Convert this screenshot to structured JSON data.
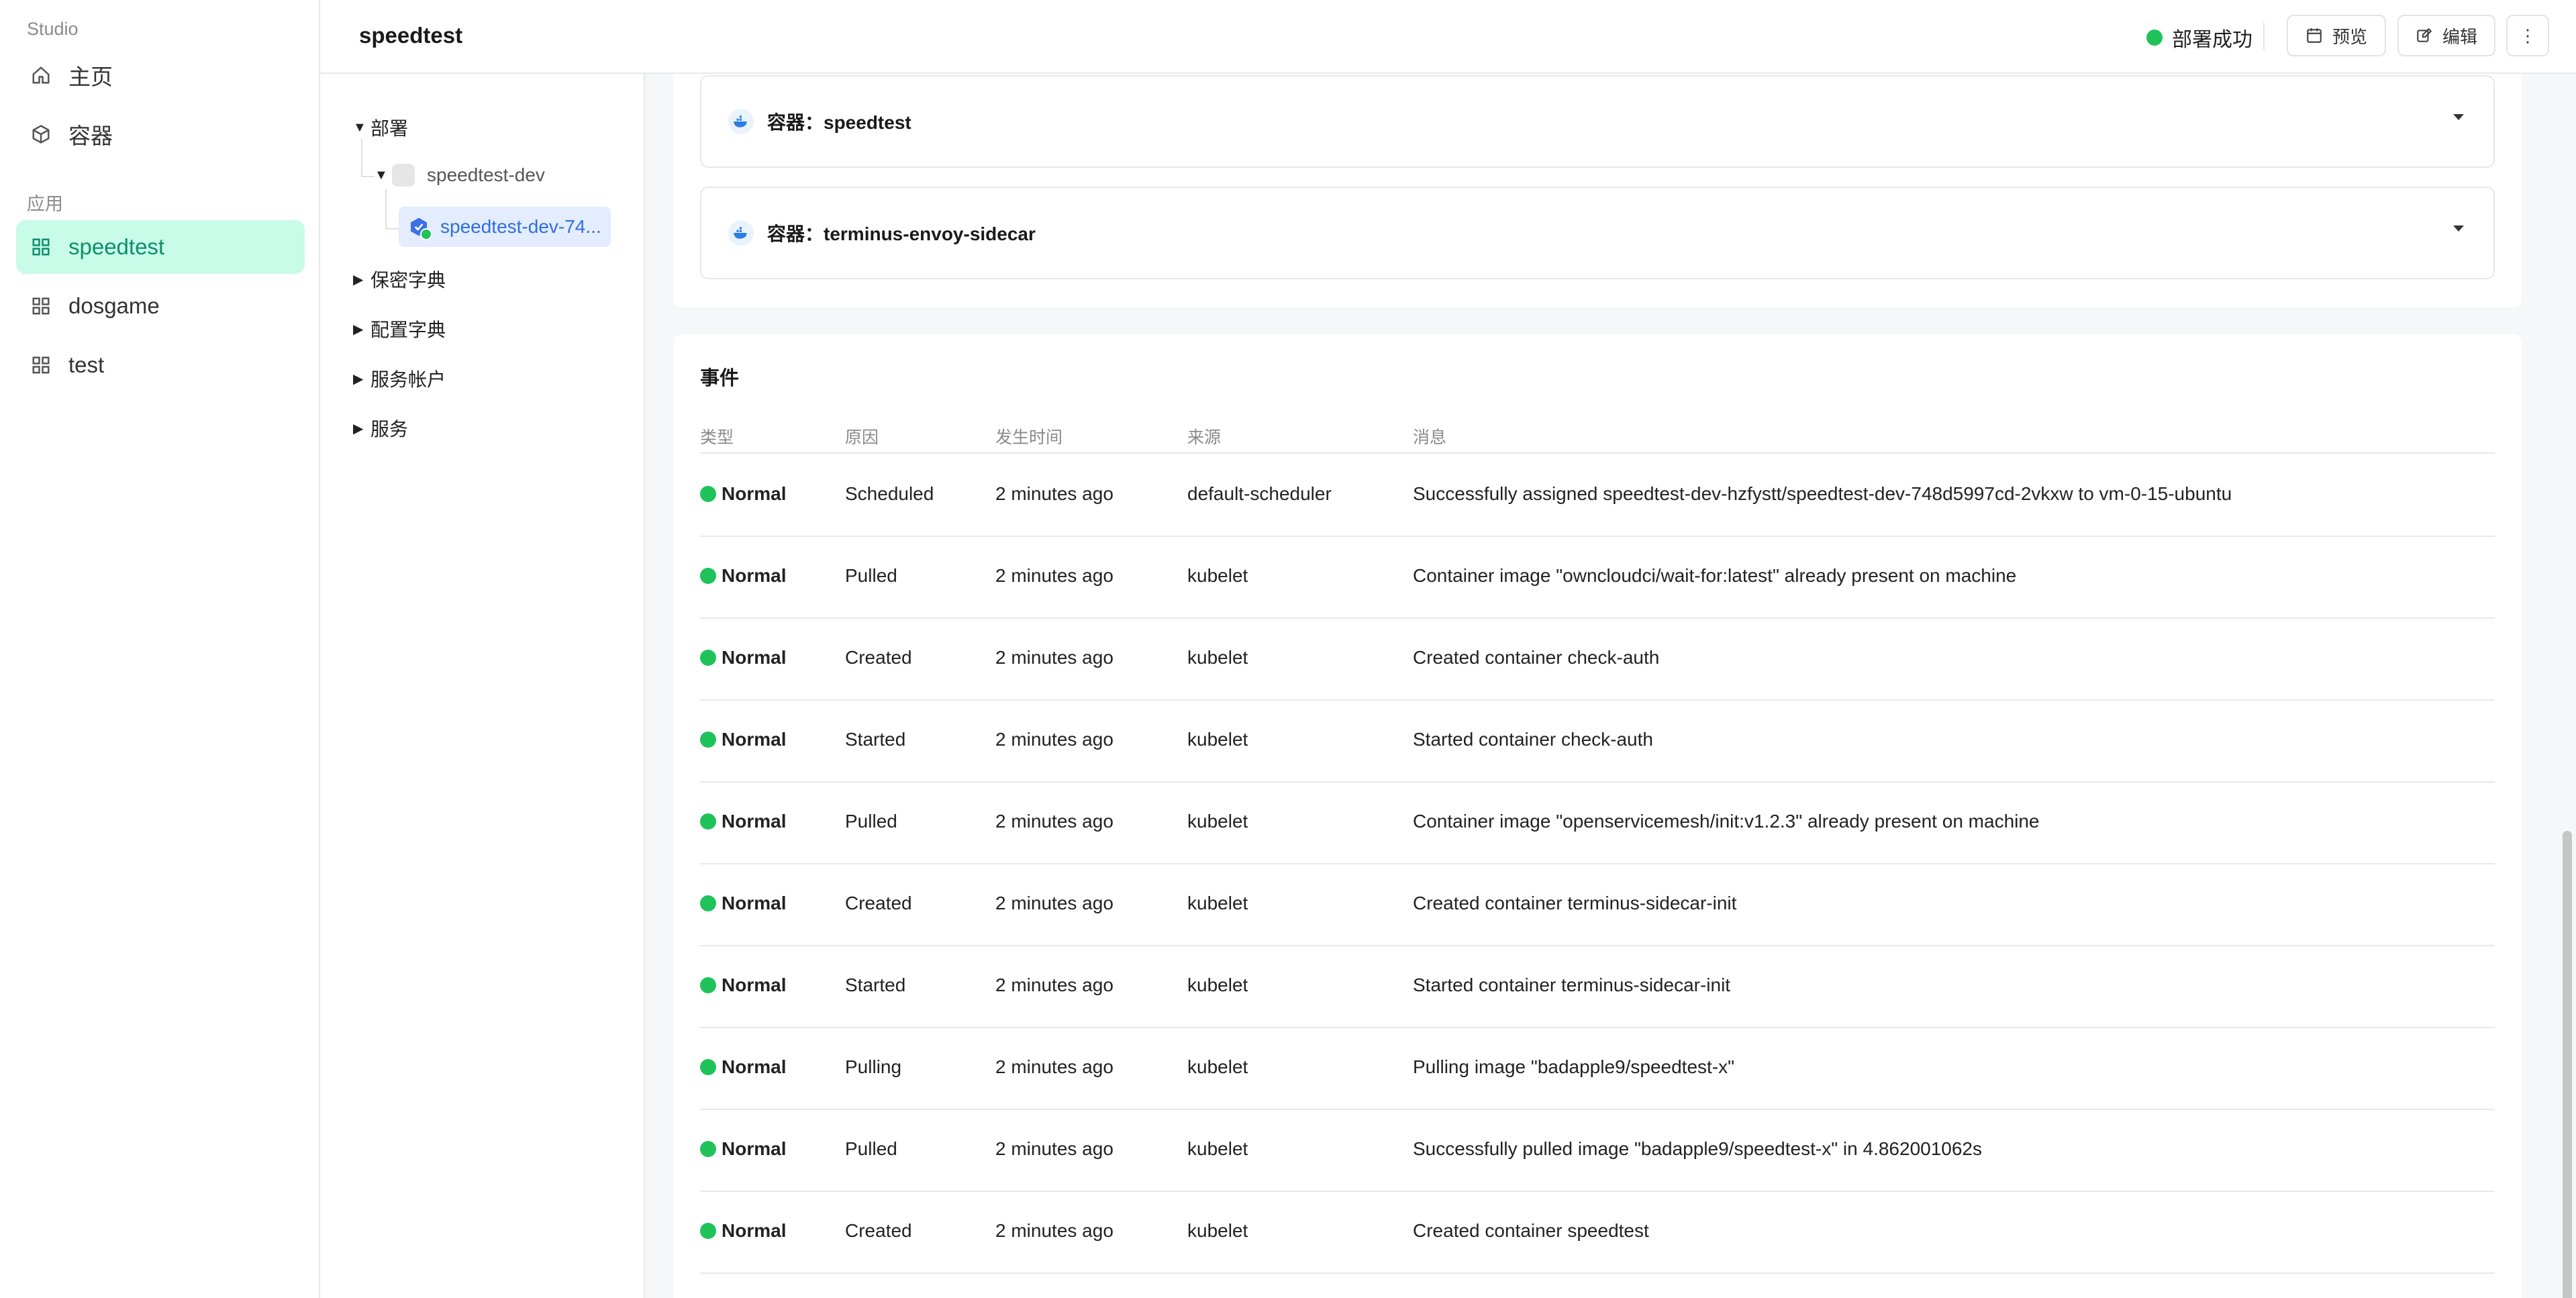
{
  "sidebar": {
    "brand": "Studio",
    "top_items": [
      {
        "label": "主页",
        "icon": "home-icon"
      },
      {
        "label": "容器",
        "icon": "cube-icon"
      }
    ],
    "section_label": "应用",
    "apps": [
      {
        "label": "speedtest",
        "icon": "grid-icon",
        "active": true
      },
      {
        "label": "dosgame",
        "icon": "grid-icon",
        "active": false
      },
      {
        "label": "test",
        "icon": "grid-icon",
        "active": false
      }
    ]
  },
  "header": {
    "title": "speedtest",
    "status_text": "部署成功",
    "status_color": "#1fc35a",
    "preview_label": "预览",
    "edit_label": "编辑",
    "more_label": "⋮"
  },
  "tree": {
    "deploy_label": "部署",
    "deployment": "speedtest-dev",
    "pod": "speedtest-dev-74...",
    "others": [
      "保密字典",
      "配置字典",
      "服务帐户",
      "服务"
    ]
  },
  "containers": [
    {
      "label": "容器：speedtest"
    },
    {
      "label": "容器：terminus-envoy-sidecar"
    }
  ],
  "events": {
    "title": "事件",
    "columns": [
      "类型",
      "原因",
      "发生时间",
      "来源",
      "消息"
    ],
    "rows": [
      {
        "type": "Normal",
        "reason": "Scheduled",
        "time": "2 minutes ago",
        "source": "default-scheduler",
        "message": "Successfully assigned speedtest-dev-hzfystt/speedtest-dev-748d5997cd-2vkxw to vm-0-15-ubuntu"
      },
      {
        "type": "Normal",
        "reason": "Pulled",
        "time": "2 minutes ago",
        "source": "kubelet",
        "message": "Container image \"owncloudci/wait-for:latest\" already present on machine"
      },
      {
        "type": "Normal",
        "reason": "Created",
        "time": "2 minutes ago",
        "source": "kubelet",
        "message": "Created container check-auth"
      },
      {
        "type": "Normal",
        "reason": "Started",
        "time": "2 minutes ago",
        "source": "kubelet",
        "message": "Started container check-auth"
      },
      {
        "type": "Normal",
        "reason": "Pulled",
        "time": "2 minutes ago",
        "source": "kubelet",
        "message": "Container image \"openservicemesh/init:v1.2.3\" already present on machine"
      },
      {
        "type": "Normal",
        "reason": "Created",
        "time": "2 minutes ago",
        "source": "kubelet",
        "message": "Created container terminus-sidecar-init"
      },
      {
        "type": "Normal",
        "reason": "Started",
        "time": "2 minutes ago",
        "source": "kubelet",
        "message": "Started container terminus-sidecar-init"
      },
      {
        "type": "Normal",
        "reason": "Pulling",
        "time": "2 minutes ago",
        "source": "kubelet",
        "message": "Pulling image \"badapple9/speedtest-x\""
      },
      {
        "type": "Normal",
        "reason": "Pulled",
        "time": "2 minutes ago",
        "source": "kubelet",
        "message": "Successfully pulled image \"badapple9/speedtest-x\" in 4.862001062s"
      },
      {
        "type": "Normal",
        "reason": "Created",
        "time": "2 minutes ago",
        "source": "kubelet",
        "message": "Created container speedtest"
      }
    ]
  }
}
